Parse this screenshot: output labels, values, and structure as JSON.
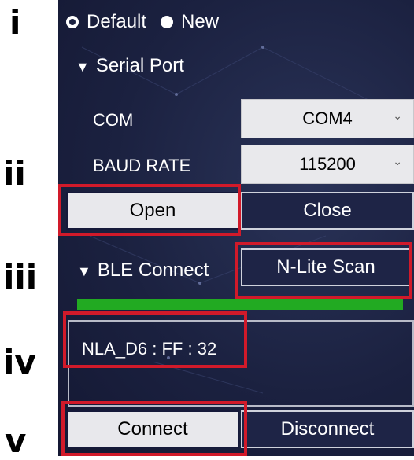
{
  "steps": [
    "i",
    "ii",
    "iii",
    "iv",
    "v"
  ],
  "radio_options": [
    {
      "label": "Default",
      "checked": true
    },
    {
      "label": "New",
      "checked": false
    }
  ],
  "serial_port": {
    "title": "Serial Port",
    "com_label": "COM",
    "com_value": "COM4",
    "baud_label": "BAUD RATE",
    "baud_value": "115200",
    "open_label": "Open",
    "close_label": "Close"
  },
  "ble": {
    "title": "BLE Connect",
    "scan_label": "N-Lite Scan",
    "progress": 1.0,
    "devices": [
      "NLA_D6 : FF : 32"
    ],
    "connect_label": "Connect",
    "disconnect_label": "Disconnect"
  },
  "colors": {
    "panel_bg": "#1b2140",
    "highlight": "#d11a2a",
    "progress": "#22aa22"
  }
}
